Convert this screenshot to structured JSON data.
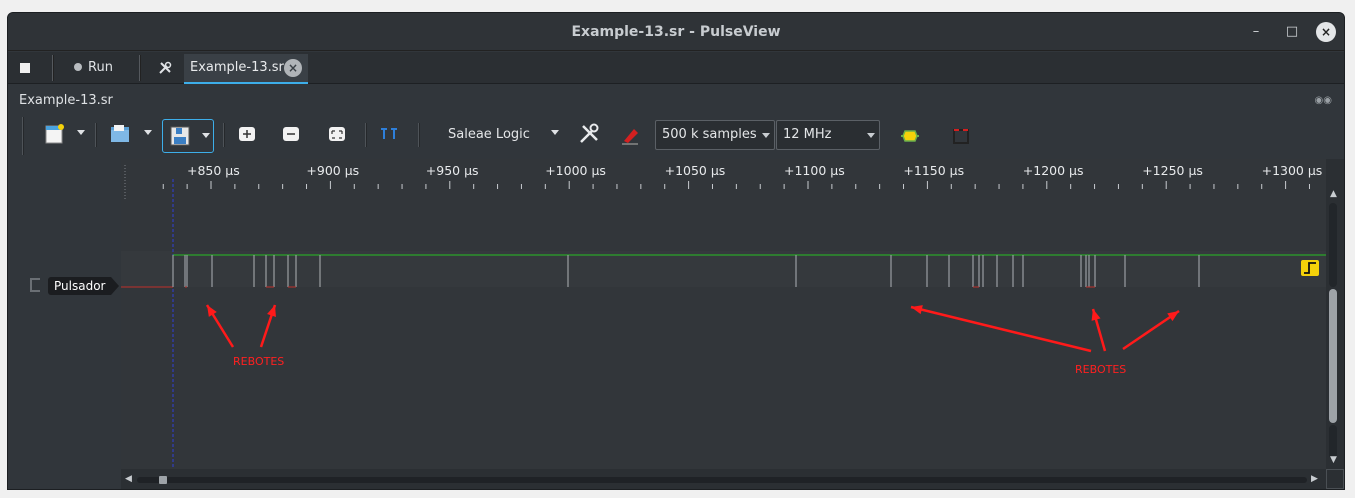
{
  "window": {
    "title": "Example-13.sr - PulseView",
    "buttons": {
      "minimize": "–",
      "maximize": "□",
      "close": "×"
    }
  },
  "tabbar": {
    "stop_icon": "stop-icon",
    "run_label": "Run",
    "settings_icon": "tools-icon",
    "tab_label": "Example-13.sr",
    "tab_close": "×"
  },
  "session": {
    "title": "Example-13.sr",
    "dock_buttons": "◉◉"
  },
  "toolbar": {
    "device": "Saleae Logic",
    "samples": "500 k samples",
    "samplerate": "12 MHz",
    "icons": [
      "new-session-icon",
      "open-file-icon",
      "save-icon",
      "zoom-in-icon",
      "zoom-out-icon",
      "zoom-fit-icon",
      "cursor-icon",
      "device-config-icon",
      "probe-config-icon",
      "decoder-icon",
      "math-icon"
    ]
  },
  "ruler": {
    "labels": [
      "+850 µs",
      "+900 µs",
      "+950 µs",
      "+1000 µs",
      "+1050 µs",
      "+1100 µs",
      "+1150 µs",
      "+1200 µs",
      "+1250 µs",
      "+1300 µs"
    ]
  },
  "signal": {
    "name": "Pulsador",
    "color": "#27c024",
    "trigger": "rising-edge-icon"
  },
  "annotations": {
    "left": "REBOTES",
    "right": "REBOTES",
    "color": "#ff2020"
  },
  "colors": {
    "background": "#32363a",
    "accent": "#3daee9",
    "trigger": "#f5d20a"
  }
}
